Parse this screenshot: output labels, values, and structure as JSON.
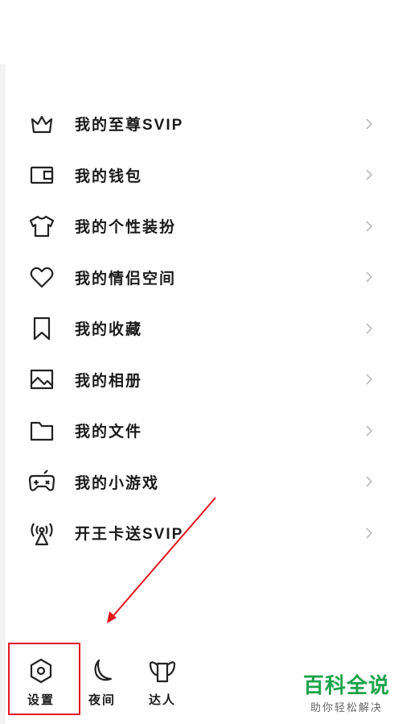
{
  "menu": {
    "items": [
      {
        "icon": "crown-icon",
        "label": "我的至尊SVIP"
      },
      {
        "icon": "wallet-icon",
        "label": "我的钱包"
      },
      {
        "icon": "tshirt-icon",
        "label": "我的个性装扮"
      },
      {
        "icon": "heart-icon",
        "label": "我的情侣空间"
      },
      {
        "icon": "bookmark-icon",
        "label": "我的收藏"
      },
      {
        "icon": "picture-icon",
        "label": "我的相册"
      },
      {
        "icon": "folder-icon",
        "label": "我的文件"
      },
      {
        "icon": "gamepad-icon",
        "label": "我的小游戏"
      },
      {
        "icon": "antenna-icon",
        "label": "开王卡送SVIP"
      }
    ]
  },
  "bottom": {
    "settings_label": "设置",
    "night_label": "夜间",
    "expert_label": "达人"
  },
  "watermark": {
    "title": "百科全说",
    "subtitle": "助你轻松解决"
  },
  "colors": {
    "annotation": "#e0161c",
    "watermark": "#1aa34a"
  }
}
